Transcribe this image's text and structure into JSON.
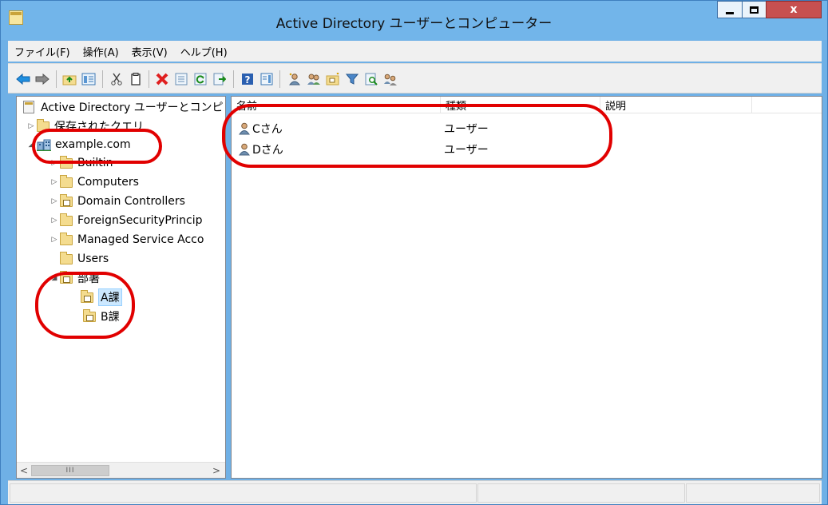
{
  "window": {
    "title": "Active Directory ユーザーとコンピューター",
    "close_glyph": "x"
  },
  "menu": [
    {
      "label": "ファイル(F)"
    },
    {
      "label": "操作(A)"
    },
    {
      "label": "表示(V)"
    },
    {
      "label": "ヘルプ(H)"
    }
  ],
  "toolbar": {
    "icons": [
      "back-arrow-icon",
      "forward-arrow-icon",
      "up-folder-icon",
      "show-hide-tree-icon",
      "cut-icon",
      "copy-icon",
      "delete-icon",
      "properties-icon",
      "refresh-icon",
      "export-list-icon",
      "help-icon",
      "show-action-pane-icon",
      "new-user-icon",
      "new-group-icon",
      "new-ou-icon",
      "filter-icon",
      "find-icon",
      "add-to-group-icon"
    ]
  },
  "tree": {
    "root": "Active Directory ユーザーとコンピ",
    "saved_queries": "保存されたクエリ",
    "domain": "example.com",
    "children": [
      {
        "label": "Builtin"
      },
      {
        "label": "Computers"
      },
      {
        "label": "Domain Controllers"
      },
      {
        "label": "ForeignSecurityPrincip"
      },
      {
        "label": "Managed Service Acco"
      },
      {
        "label": "Users"
      }
    ],
    "ou": "部署",
    "ou_children": [
      {
        "label": "A課",
        "selected": true
      },
      {
        "label": "B課",
        "selected": false
      }
    ],
    "scroll_thumb": "III"
  },
  "list": {
    "columns": [
      "名前",
      "種類",
      "説明"
    ],
    "rows": [
      {
        "name": "Cさん",
        "type": "ユーザー",
        "description": ""
      },
      {
        "name": "Dさん",
        "type": "ユーザー",
        "description": ""
      }
    ]
  },
  "colors": {
    "titlebar": "#72b5ea",
    "annotation": "#e10000",
    "selection": "#cce8ff"
  }
}
